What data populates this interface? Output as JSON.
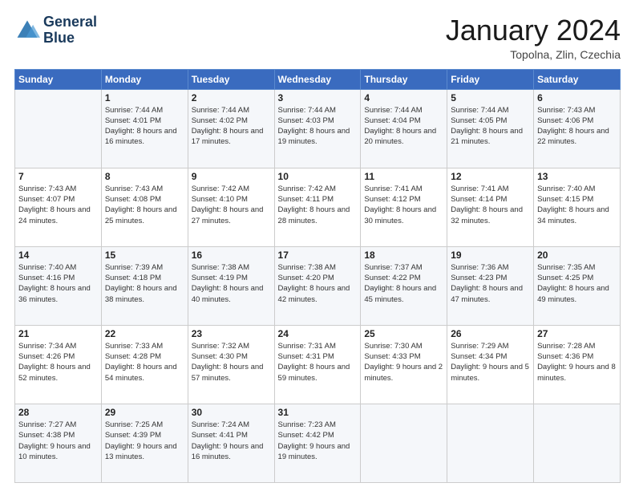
{
  "header": {
    "logo_line1": "General",
    "logo_line2": "Blue",
    "title": "January 2024",
    "subtitle": "Topolna, Zlin, Czechia"
  },
  "weekdays": [
    "Sunday",
    "Monday",
    "Tuesday",
    "Wednesday",
    "Thursday",
    "Friday",
    "Saturday"
  ],
  "weeks": [
    [
      {
        "day": "",
        "sunrise": "",
        "sunset": "",
        "daylight": ""
      },
      {
        "day": "1",
        "sunrise": "7:44 AM",
        "sunset": "4:01 PM",
        "daylight": "8 hours and 16 minutes."
      },
      {
        "day": "2",
        "sunrise": "7:44 AM",
        "sunset": "4:02 PM",
        "daylight": "8 hours and 17 minutes."
      },
      {
        "day": "3",
        "sunrise": "7:44 AM",
        "sunset": "4:03 PM",
        "daylight": "8 hours and 19 minutes."
      },
      {
        "day": "4",
        "sunrise": "7:44 AM",
        "sunset": "4:04 PM",
        "daylight": "8 hours and 20 minutes."
      },
      {
        "day": "5",
        "sunrise": "7:44 AM",
        "sunset": "4:05 PM",
        "daylight": "8 hours and 21 minutes."
      },
      {
        "day": "6",
        "sunrise": "7:43 AM",
        "sunset": "4:06 PM",
        "daylight": "8 hours and 22 minutes."
      }
    ],
    [
      {
        "day": "7",
        "sunrise": "7:43 AM",
        "sunset": "4:07 PM",
        "daylight": "8 hours and 24 minutes."
      },
      {
        "day": "8",
        "sunrise": "7:43 AM",
        "sunset": "4:08 PM",
        "daylight": "8 hours and 25 minutes."
      },
      {
        "day": "9",
        "sunrise": "7:42 AM",
        "sunset": "4:10 PM",
        "daylight": "8 hours and 27 minutes."
      },
      {
        "day": "10",
        "sunrise": "7:42 AM",
        "sunset": "4:11 PM",
        "daylight": "8 hours and 28 minutes."
      },
      {
        "day": "11",
        "sunrise": "7:41 AM",
        "sunset": "4:12 PM",
        "daylight": "8 hours and 30 minutes."
      },
      {
        "day": "12",
        "sunrise": "7:41 AM",
        "sunset": "4:14 PM",
        "daylight": "8 hours and 32 minutes."
      },
      {
        "day": "13",
        "sunrise": "7:40 AM",
        "sunset": "4:15 PM",
        "daylight": "8 hours and 34 minutes."
      }
    ],
    [
      {
        "day": "14",
        "sunrise": "7:40 AM",
        "sunset": "4:16 PM",
        "daylight": "8 hours and 36 minutes."
      },
      {
        "day": "15",
        "sunrise": "7:39 AM",
        "sunset": "4:18 PM",
        "daylight": "8 hours and 38 minutes."
      },
      {
        "day": "16",
        "sunrise": "7:38 AM",
        "sunset": "4:19 PM",
        "daylight": "8 hours and 40 minutes."
      },
      {
        "day": "17",
        "sunrise": "7:38 AM",
        "sunset": "4:20 PM",
        "daylight": "8 hours and 42 minutes."
      },
      {
        "day": "18",
        "sunrise": "7:37 AM",
        "sunset": "4:22 PM",
        "daylight": "8 hours and 45 minutes."
      },
      {
        "day": "19",
        "sunrise": "7:36 AM",
        "sunset": "4:23 PM",
        "daylight": "8 hours and 47 minutes."
      },
      {
        "day": "20",
        "sunrise": "7:35 AM",
        "sunset": "4:25 PM",
        "daylight": "8 hours and 49 minutes."
      }
    ],
    [
      {
        "day": "21",
        "sunrise": "7:34 AM",
        "sunset": "4:26 PM",
        "daylight": "8 hours and 52 minutes."
      },
      {
        "day": "22",
        "sunrise": "7:33 AM",
        "sunset": "4:28 PM",
        "daylight": "8 hours and 54 minutes."
      },
      {
        "day": "23",
        "sunrise": "7:32 AM",
        "sunset": "4:30 PM",
        "daylight": "8 hours and 57 minutes."
      },
      {
        "day": "24",
        "sunrise": "7:31 AM",
        "sunset": "4:31 PM",
        "daylight": "8 hours and 59 minutes."
      },
      {
        "day": "25",
        "sunrise": "7:30 AM",
        "sunset": "4:33 PM",
        "daylight": "9 hours and 2 minutes."
      },
      {
        "day": "26",
        "sunrise": "7:29 AM",
        "sunset": "4:34 PM",
        "daylight": "9 hours and 5 minutes."
      },
      {
        "day": "27",
        "sunrise": "7:28 AM",
        "sunset": "4:36 PM",
        "daylight": "9 hours and 8 minutes."
      }
    ],
    [
      {
        "day": "28",
        "sunrise": "7:27 AM",
        "sunset": "4:38 PM",
        "daylight": "9 hours and 10 minutes."
      },
      {
        "day": "29",
        "sunrise": "7:25 AM",
        "sunset": "4:39 PM",
        "daylight": "9 hours and 13 minutes."
      },
      {
        "day": "30",
        "sunrise": "7:24 AM",
        "sunset": "4:41 PM",
        "daylight": "9 hours and 16 minutes."
      },
      {
        "day": "31",
        "sunrise": "7:23 AM",
        "sunset": "4:42 PM",
        "daylight": "9 hours and 19 minutes."
      },
      {
        "day": "",
        "sunrise": "",
        "sunset": "",
        "daylight": ""
      },
      {
        "day": "",
        "sunrise": "",
        "sunset": "",
        "daylight": ""
      },
      {
        "day": "",
        "sunrise": "",
        "sunset": "",
        "daylight": ""
      }
    ]
  ],
  "labels": {
    "sunrise_prefix": "Sunrise: ",
    "sunset_prefix": "Sunset: ",
    "daylight_prefix": "Daylight: "
  }
}
